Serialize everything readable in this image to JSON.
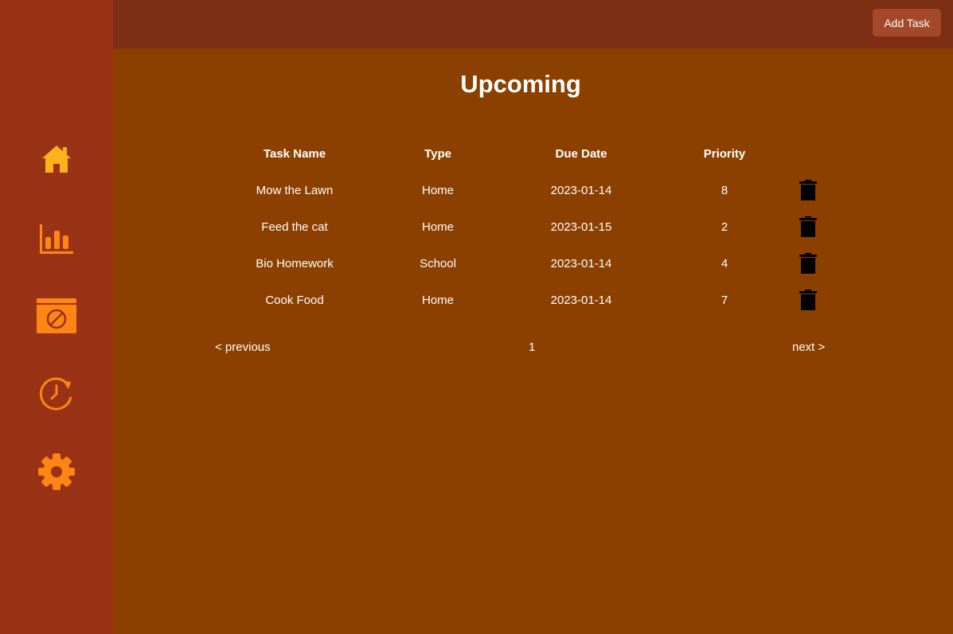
{
  "colors": {
    "sidebar_bg": "#9a3216",
    "topbar_bg": "#7d2e13",
    "main_bg": "#8b4000",
    "icon_accent": "#ff8515",
    "home_icon": "#ffb21c",
    "button_bg": "#a4482a"
  },
  "sidebar": {
    "items": [
      {
        "icon": "home-icon"
      },
      {
        "icon": "bar-chart-icon"
      },
      {
        "icon": "blocked-calendar-icon"
      },
      {
        "icon": "clock-refresh-icon"
      },
      {
        "icon": "gear-icon"
      }
    ]
  },
  "topbar": {
    "add_task_label": "Add Task"
  },
  "main": {
    "title": "Upcoming",
    "columns": [
      "Task Name",
      "Type",
      "Due Date",
      "Priority"
    ],
    "rows": [
      {
        "name": "Mow the Lawn",
        "type": "Home",
        "due": "2023-01-14",
        "priority": "8"
      },
      {
        "name": "Feed the cat",
        "type": "Home",
        "due": "2023-01-15",
        "priority": "2"
      },
      {
        "name": "Bio Homework",
        "type": "School",
        "due": "2023-01-14",
        "priority": "4"
      },
      {
        "name": "Cook Food",
        "type": "Home",
        "due": "2023-01-14",
        "priority": "7"
      }
    ],
    "delete_icon": "trash-icon"
  },
  "pagination": {
    "prev": "< previous",
    "page": "1",
    "next": "next >"
  }
}
